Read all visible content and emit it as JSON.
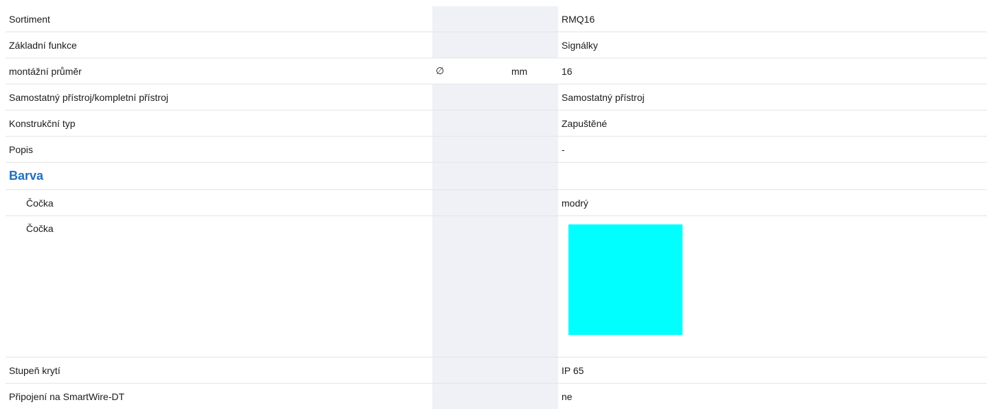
{
  "colors": {
    "heading_blue": "#1f6fc0",
    "column_bg": "#f0f1f6",
    "lens_swatch": "#00ffff"
  },
  "rows": [
    {
      "label": "Sortiment",
      "symbol": "",
      "unit": "",
      "value": "RMQ16"
    },
    {
      "label": "Základní funkce",
      "symbol": "",
      "unit": "",
      "value": "Signálky"
    },
    {
      "label": "montážní průměr",
      "symbol": "∅",
      "unit": "mm",
      "value": "16"
    },
    {
      "label": "Samostatný přístroj/kompletní přístroj",
      "symbol": "",
      "unit": "",
      "value": "Samostatný přístroj"
    },
    {
      "label": "Konstrukční typ",
      "symbol": "",
      "unit": "",
      "value": "Zapuštěné"
    },
    {
      "label": "Popis",
      "symbol": "",
      "unit": "",
      "value": "-"
    }
  ],
  "barva": {
    "title": "Barva",
    "lens_label": "Čočka",
    "lens_value": "modrý",
    "lens_swatch_label": "Čočka"
  },
  "rows_after": [
    {
      "label": "Stupeň krytí",
      "value": "IP 65"
    },
    {
      "label": "Připojení na SmartWire-DT",
      "value": "ne"
    }
  ]
}
